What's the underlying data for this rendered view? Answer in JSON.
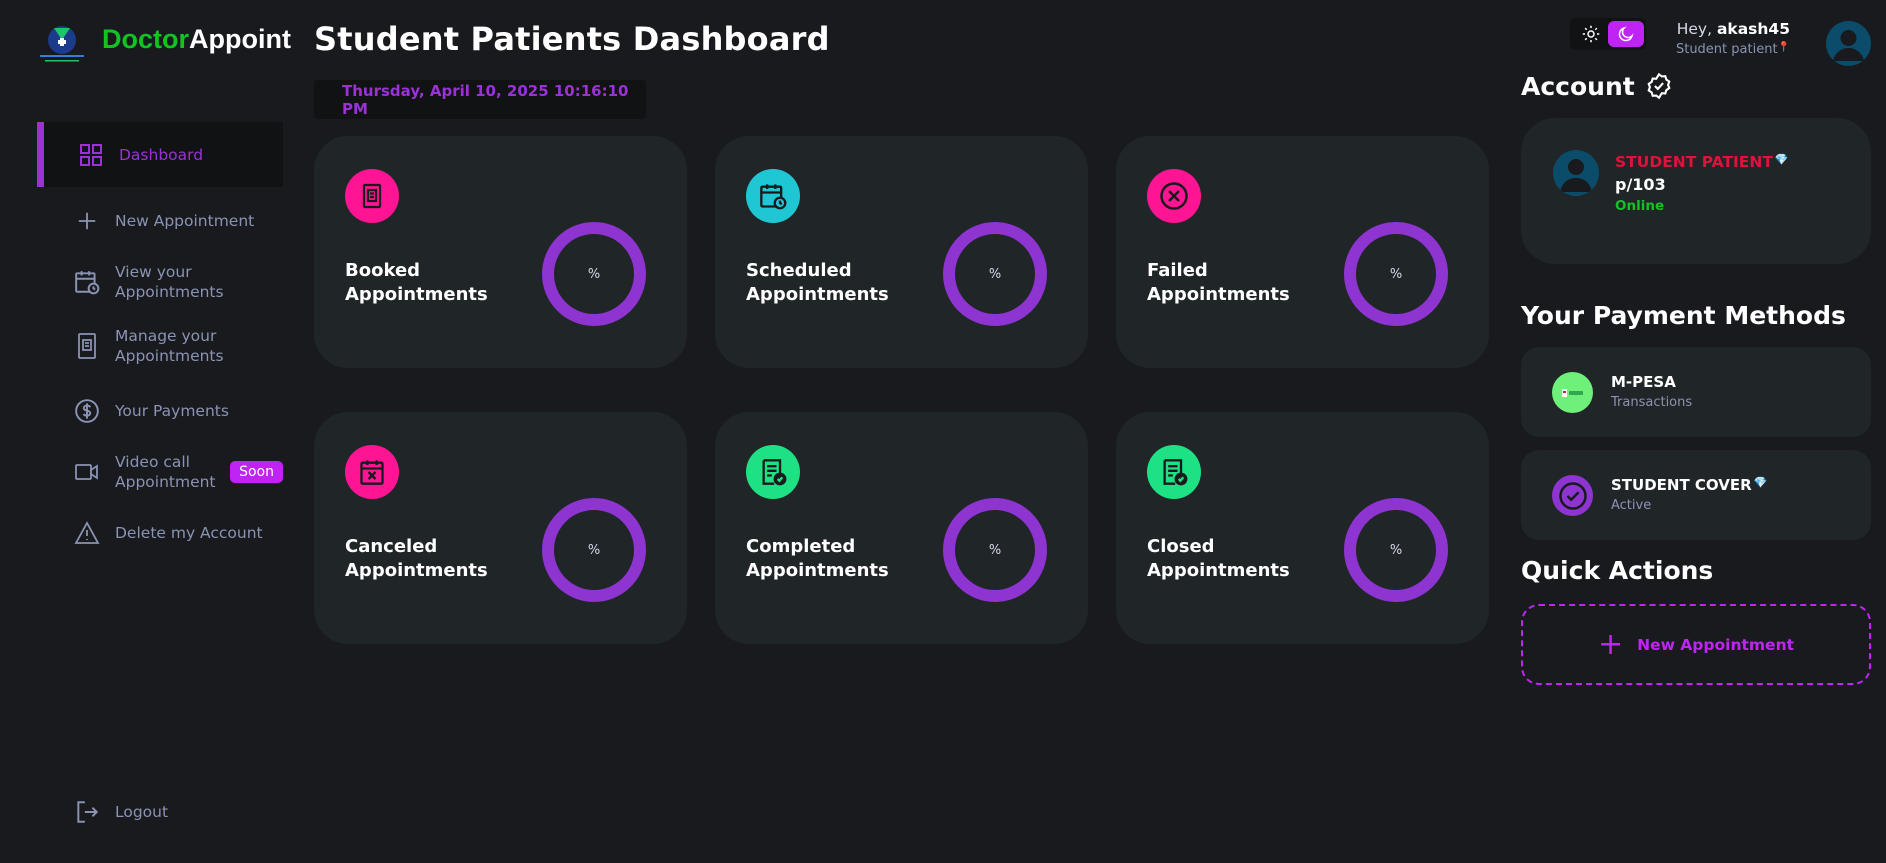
{
  "brand": {
    "part1": "Doctor",
    "part2": "Appoint"
  },
  "page": {
    "title": "Student Patients Dashboard",
    "datetime": "Thursday, April 10, 2025 10:16:10 PM"
  },
  "sidebar": {
    "items": [
      {
        "label": "Dashboard",
        "icon": "grid-icon",
        "active": true
      },
      {
        "label": "New Appointment",
        "icon": "plus-icon"
      },
      {
        "label": "View your Appointments",
        "icon": "calendar-clock-icon"
      },
      {
        "label": "Manage your Appointments",
        "icon": "receipt-icon"
      },
      {
        "label": "Your Payments",
        "icon": "dollar-icon"
      },
      {
        "label": "Video call Appointment",
        "icon": "video-icon",
        "badge": "Soon"
      },
      {
        "label": "Delete my Account",
        "icon": "warning-icon"
      }
    ],
    "logout": "Logout"
  },
  "cards": [
    {
      "label": "Booked Appointments",
      "percent": "%",
      "icon": "receipt-icon",
      "color": "#ff1493"
    },
    {
      "label": "Scheduled Appointments",
      "percent": "%",
      "icon": "calendar-clock-icon",
      "color": "#1fc7d4"
    },
    {
      "label": "Failed Appointments",
      "percent": "%",
      "icon": "x-circle-icon",
      "color": "#ff1493"
    },
    {
      "label": "Canceled Appointments",
      "percent": "%",
      "icon": "calendar-x-icon",
      "color": "#ff1493"
    },
    {
      "label": "Completed Appointments",
      "percent": "%",
      "icon": "document-check-icon",
      "color": "#1de182"
    },
    {
      "label": "Closed Appointments",
      "percent": "%",
      "icon": "document-check-icon",
      "color": "#1de182"
    }
  ],
  "header": {
    "hey": "Hey,",
    "username": "akash45",
    "role": "Student patient"
  },
  "account": {
    "title": "Account",
    "type": "STUDENT PATIENT",
    "id": "p/103",
    "status": "Online"
  },
  "payments": {
    "title": "Your Payment Methods",
    "methods": [
      {
        "name": "M-PESA",
        "sub": "Transactions",
        "color": "#6ef07a"
      },
      {
        "name": "STUDENT COVER",
        "sub": "Active",
        "color": "#8e34d0"
      }
    ]
  },
  "quick_actions": {
    "title": "Quick Actions",
    "new_appointment": "New Appointment"
  },
  "colors": {
    "accent": "#9b32d8",
    "magenta": "#c024f5",
    "card": "#202528",
    "bg": "#181a1e",
    "green": "#11c421",
    "red": "#e0113b"
  }
}
